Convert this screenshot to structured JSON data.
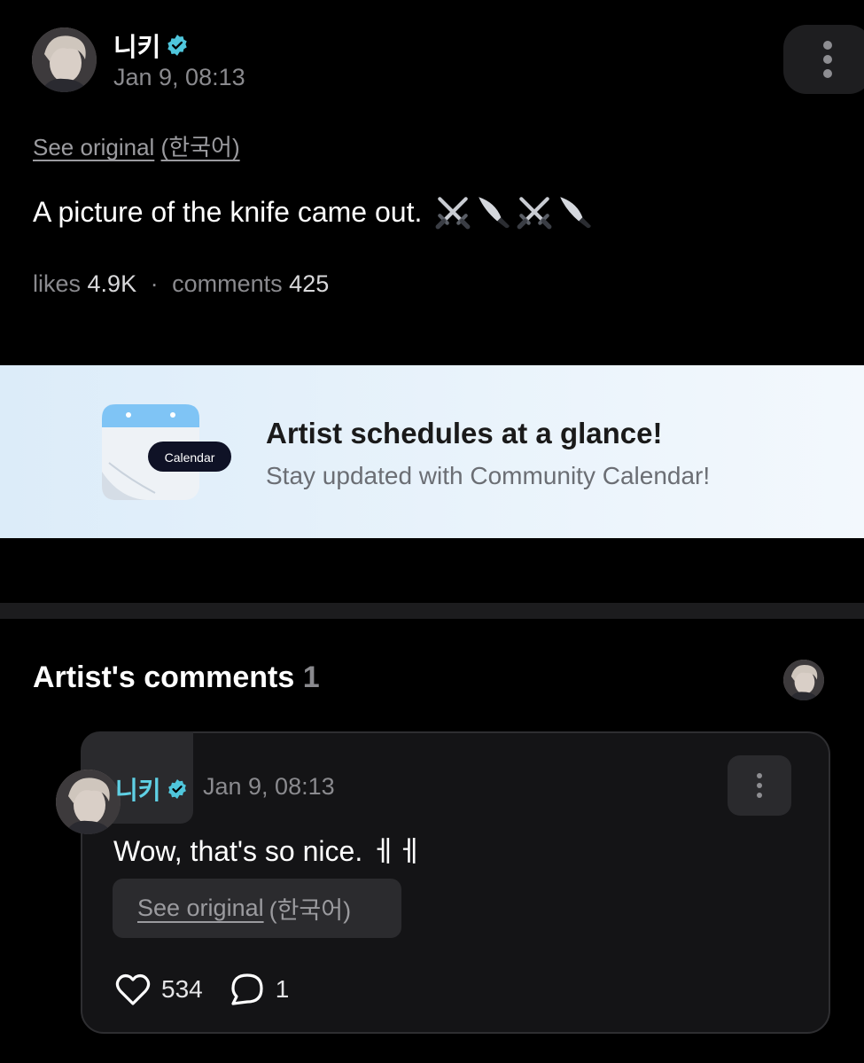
{
  "post": {
    "author": "니키",
    "date": "Jan 9, 08:13",
    "see_original": "See original",
    "original_lang": "(한국어)",
    "body": "A picture of the knife came out.",
    "likes_label": "likes",
    "likes_count": "4.9K",
    "separator": "·",
    "comments_label": "comments",
    "comments_count": "425"
  },
  "banner": {
    "icon_label": "Calendar",
    "title": "Artist schedules at a glance!",
    "subtitle": "Stay updated with Community Calendar!"
  },
  "artist_comments": {
    "title": "Artist's comments",
    "count": "1",
    "comment": {
      "author": "니키",
      "date": "Jan 9, 08:13",
      "body": "Wow, that's so nice. ㅔㅔ",
      "see_original": "See original",
      "original_lang": "(한국어)",
      "likes": "534",
      "replies": "1"
    }
  },
  "icons": {
    "verified_color": "#4fc6dc",
    "verified": "verified-badge-icon",
    "more": "more-vertical-icon",
    "emoji": [
      "crossed-swords-icon",
      "kitchen-knife-icon",
      "crossed-swords-icon",
      "kitchen-knife-icon"
    ],
    "heart": "heart-icon",
    "reply": "speech-bubble-icon"
  }
}
